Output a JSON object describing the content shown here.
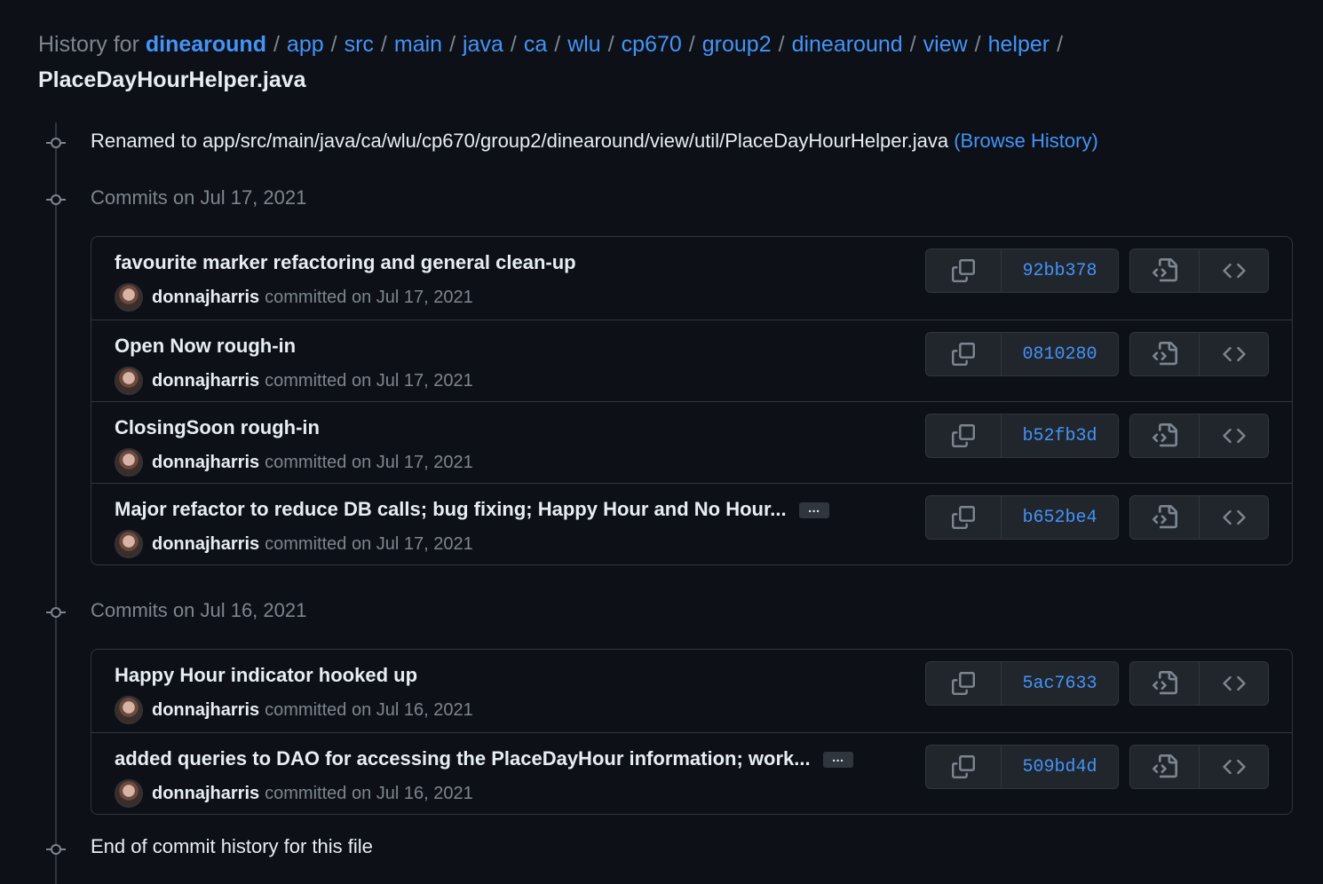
{
  "breadcrumb": {
    "prefix": "History for",
    "root": "dinearound",
    "segments": [
      "app",
      "src",
      "main",
      "java",
      "ca",
      "wlu",
      "cp670",
      "group2",
      "dinearound",
      "view",
      "helper"
    ],
    "separator": "/",
    "file": "PlaceDayHourHelper.java"
  },
  "rename": {
    "text": "Renamed to app/src/main/java/ca/wlu/cp670/group2/dinearound/view/util/PlaceDayHourHelper.java",
    "link": "(Browse History)"
  },
  "groups": [
    {
      "heading": "Commits on Jul 17, 2021",
      "commits": [
        {
          "title": "favourite marker refactoring and general clean-up",
          "author": "donnajharris",
          "date_text": "committed on Jul 17, 2021",
          "sha": "92bb378",
          "truncated": false
        },
        {
          "title": "Open Now rough-in",
          "author": "donnajharris",
          "date_text": "committed on Jul 17, 2021",
          "sha": "0810280",
          "truncated": false
        },
        {
          "title": "ClosingSoon rough-in",
          "author": "donnajharris",
          "date_text": "committed on Jul 17, 2021",
          "sha": "b52fb3d",
          "truncated": false
        },
        {
          "title": "Major refactor to reduce DB calls; bug fixing; Happy Hour and No Hour...",
          "author": "donnajharris",
          "date_text": "committed on Jul 17, 2021",
          "sha": "b652be4",
          "truncated": true
        }
      ]
    },
    {
      "heading": "Commits on Jul 16, 2021",
      "commits": [
        {
          "title": "Happy Hour indicator hooked up",
          "author": "donnajharris",
          "date_text": "committed on Jul 16, 2021",
          "sha": "5ac7633",
          "truncated": false
        },
        {
          "title": "added queries to DAO for accessing the PlaceDayHour information; work...",
          "author": "donnajharris",
          "date_text": "committed on Jul 16, 2021",
          "sha": "509bd4d",
          "truncated": true
        }
      ]
    }
  ],
  "end_text": "End of commit history for this file",
  "ellipsis_label": "…",
  "icons": {
    "copy": "copy-icon",
    "browse": "file-code-icon",
    "code": "code-icon",
    "commit_node": "git-commit-icon"
  },
  "colors": {
    "background": "#0d1117",
    "link": "#4493f8",
    "muted": "#7d8590",
    "text": "#e6edf3",
    "border": "#30363d",
    "button": "#21262d"
  }
}
